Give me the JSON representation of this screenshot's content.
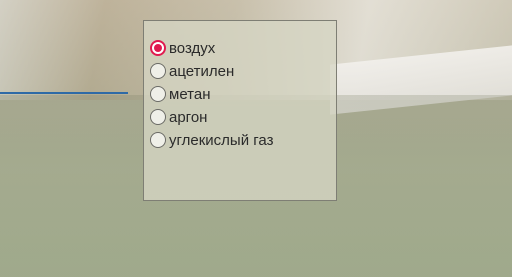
{
  "quiz": {
    "options": [
      {
        "label": "воздух",
        "selected": true
      },
      {
        "label": "ацетилен",
        "selected": false
      },
      {
        "label": "метан",
        "selected": false
      },
      {
        "label": "аргон",
        "selected": false
      },
      {
        "label": "углекислый газ",
        "selected": false
      }
    ]
  },
  "colors": {
    "selected_radio": "#e01a4f",
    "divider_line": "#2f6aa6"
  }
}
